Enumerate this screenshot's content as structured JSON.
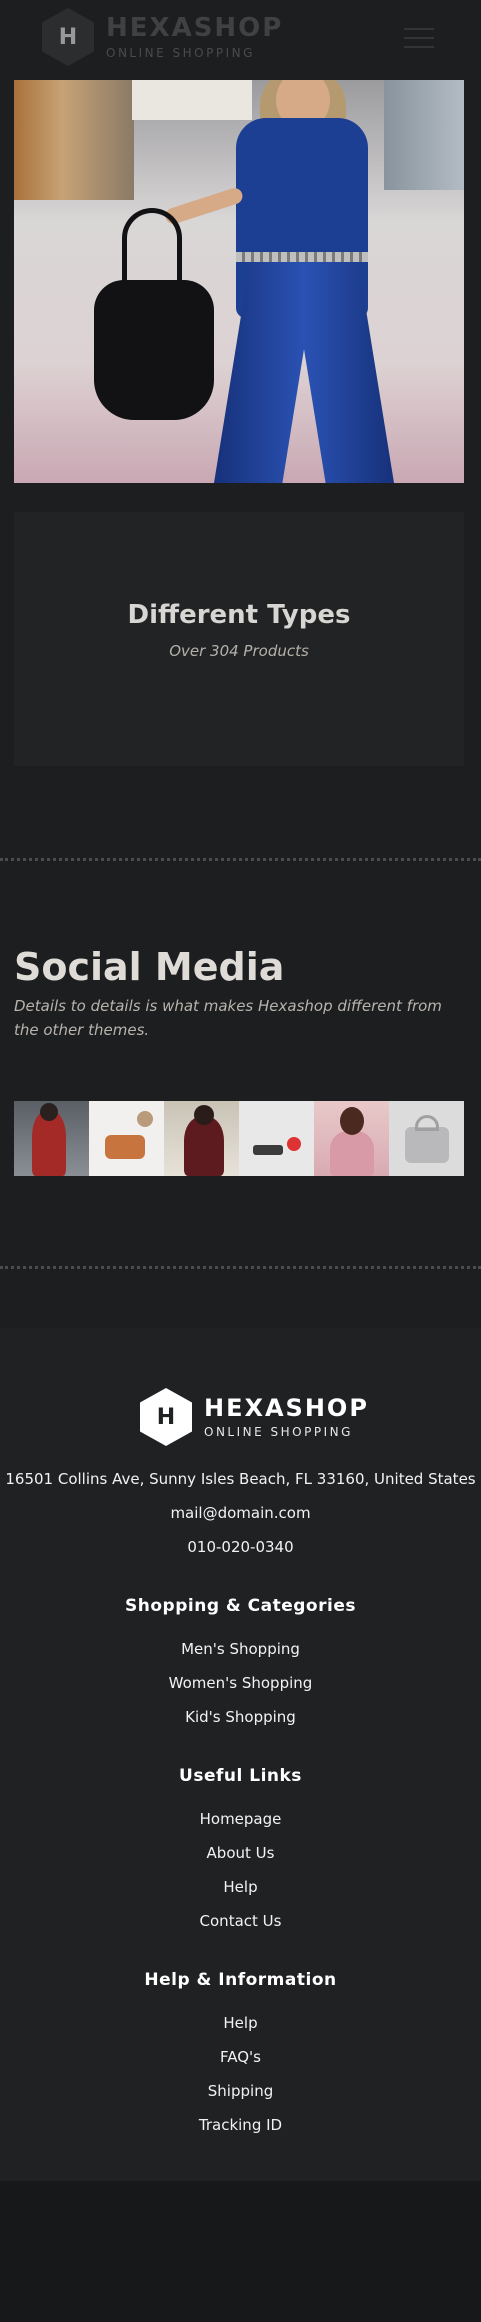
{
  "header": {
    "logo_letter": "H",
    "brand_name": "HEXASHOP",
    "brand_tagline": "ONLINE SHOPPING",
    "menu_icon": "hamburger-menu-icon"
  },
  "hero": {
    "image_subject": "hero-fashion-photo"
  },
  "types": {
    "title": "Different Types",
    "subtitle": "Over 304 Products"
  },
  "social": {
    "title": "Social Media",
    "description": "Details to details is what makes Hexashop different from the other themes.",
    "gallery_count": 6
  },
  "footer": {
    "logo_letter": "H",
    "brand_name": "HEXASHOP",
    "brand_tagline": "ONLINE SHOPPING",
    "address": "16501 Collins Ave, Sunny Isles Beach, FL 33160, United States",
    "email": "mail@domain.com",
    "phone": "010-020-0340",
    "sections": [
      {
        "title": "Shopping & Categories",
        "links": [
          "Men's Shopping",
          "Women's Shopping",
          "Kid's Shopping"
        ]
      },
      {
        "title": "Useful Links",
        "links": [
          "Homepage",
          "About Us",
          "Help",
          "Contact Us"
        ]
      },
      {
        "title": "Help & Information",
        "links": [
          "Help",
          "FAQ's",
          "Shipping",
          "Tracking ID"
        ]
      }
    ]
  },
  "colors": {
    "background": "#1d1e20",
    "footer_bg": "#202123",
    "accent_text": "#ffffff"
  }
}
